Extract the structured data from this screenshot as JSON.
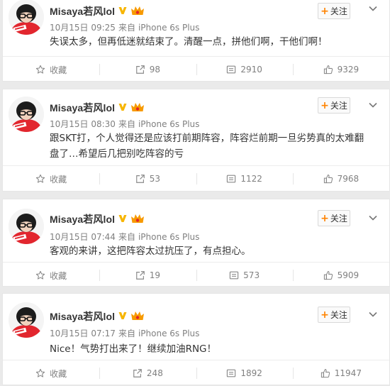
{
  "colors": {
    "accent": "#ff8200",
    "text": "#333333",
    "meta": "#808080",
    "background": "#eaeaea"
  },
  "posts": [
    {
      "username": "Misaya若风lol",
      "time": "10月15日 09:25",
      "from": "来自",
      "device": "iPhone 6s Plus",
      "content": "失误太多，但再低迷就结束了。清醒一点，拼他们啊，干他们啊！",
      "follow_label": "关注",
      "favorite_label": "收藏",
      "reposts": "98",
      "comments": "2910",
      "likes": "9329"
    },
    {
      "username": "Misaya若风lol",
      "time": "10月15日 08:30",
      "from": "来自",
      "device": "iPhone 6s Plus",
      "content": "跟SKT打，个人觉得还是应该打前期阵容，阵容烂前期一旦劣势真的太难翻盘了…希望后几把别吃阵容的亏",
      "follow_label": "关注",
      "favorite_label": "收藏",
      "reposts": "53",
      "comments": "1122",
      "likes": "7968"
    },
    {
      "username": "Misaya若风lol",
      "time": "10月15日 07:44",
      "from": "来自",
      "device": "iPhone 6s Plus",
      "content": "客观的来讲，这把阵容太过抗压了，有点担心。",
      "follow_label": "关注",
      "favorite_label": "收藏",
      "reposts": "19",
      "comments": "573",
      "likes": "5909"
    },
    {
      "username": "Misaya若风lol",
      "time": "10月15日 07:17",
      "from": "来自",
      "device": "iPhone 6s Plus",
      "content": "Nice！气势打出来了！继续加油RNG！",
      "follow_label": "关注",
      "favorite_label": "收藏",
      "reposts": "248",
      "comments": "1892",
      "likes": "11947"
    }
  ]
}
